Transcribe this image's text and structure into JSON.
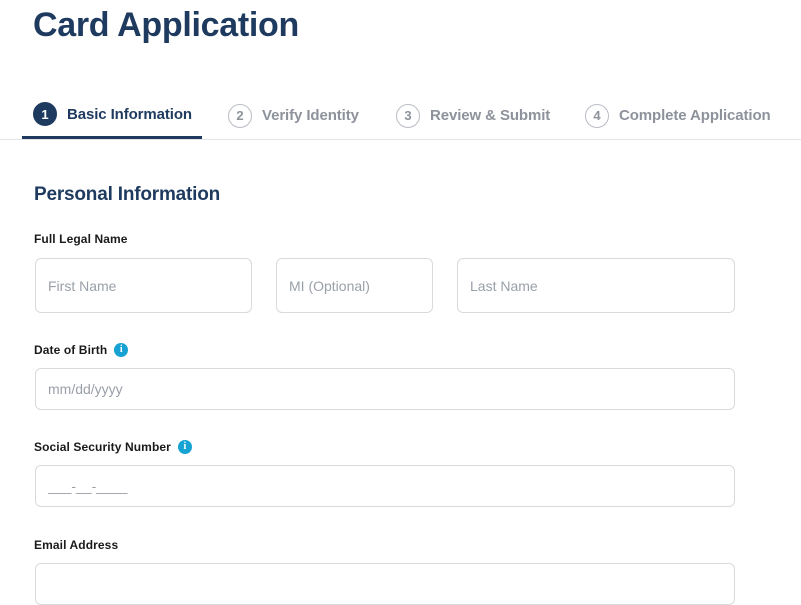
{
  "page": {
    "title": "Card Application"
  },
  "stepper": {
    "steps": [
      {
        "number": "1",
        "label": "Basic Information",
        "state": "active"
      },
      {
        "number": "2",
        "label": "Verify Identity",
        "state": "inactive"
      },
      {
        "number": "3",
        "label": "Review & Submit",
        "state": "inactive"
      },
      {
        "number": "4",
        "label": "Complete Application",
        "state": "inactive"
      }
    ]
  },
  "form": {
    "section_title": "Personal Information",
    "fields": {
      "full_legal_name": {
        "label": "Full Legal Name",
        "first_name": {
          "value": "",
          "placeholder": "First Name"
        },
        "middle_initial": {
          "value": "",
          "placeholder": "MI (Optional)"
        },
        "last_name": {
          "value": "",
          "placeholder": "Last Name"
        }
      },
      "date_of_birth": {
        "label": "Date of Birth",
        "info_icon": "info-icon",
        "info_glyph": "i",
        "value": "",
        "placeholder": "mm/dd/yyyy"
      },
      "social_security_number": {
        "label": "Social Security Number",
        "info_icon": "info-icon",
        "info_glyph": "i",
        "value": "",
        "placeholder": "___-__-____"
      },
      "email_address": {
        "label": "Email Address",
        "value": "",
        "placeholder": ""
      }
    }
  },
  "colors": {
    "brand_navy": "#1e3a5f",
    "info_blue": "#17a2d4",
    "border_gray": "#d8dade",
    "muted_text": "#8d929b",
    "placeholder": "#9aa0a8"
  }
}
